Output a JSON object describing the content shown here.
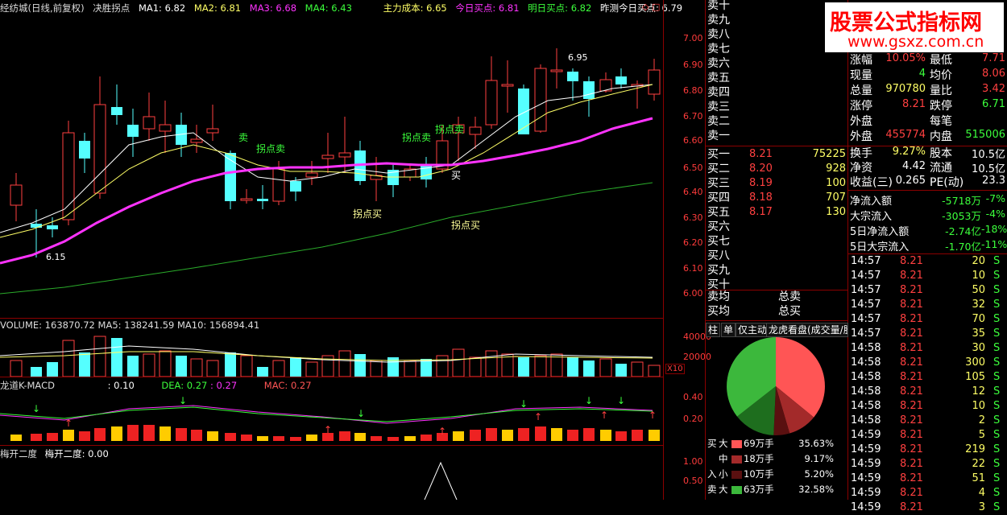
{
  "header": {
    "stock": "经纺城(日线,前复权)",
    "indicator": "决胜拐点",
    "ma1": "MA1: 6.82",
    "ma2": "MA2: 6.81",
    "ma3": "MA3: 6.68",
    "ma4": "MA4: 6.43",
    "cost": "主力成本: 6.65",
    "today_buy": "今日买点: 6.81",
    "tomorrow_buy": "明日买点: 6.82",
    "yesterday_buy": "昨测今日买点: 6.79",
    "corner": "◇ □"
  },
  "price_axis": [
    "7.00",
    "6.90",
    "6.80",
    "6.70",
    "6.60",
    "6.50",
    "6.40",
    "6.30",
    "6.20",
    "6.10",
    "6.00"
  ],
  "annotations": {
    "high": "6.95",
    "low": "6.15",
    "sell1": "卖",
    "sell2": "拐点卖",
    "sell3": "拐点卖",
    "sell4": "拐点卖",
    "buy1": "买",
    "buy2": "拐点买",
    "buy3": "拐点买"
  },
  "volume": {
    "header": "VOLUME: 163870.72  MA5: 138241.59  MA10: 156894.41",
    "axis": [
      "40000",
      "20000"
    ],
    "unit": "X10"
  },
  "macd": {
    "title": "龙道K-MACD",
    "diff": ": 0.10",
    "dea": "DEA: 0.27",
    "dea2": ": 0.27",
    "mac": "MAC: 0.27",
    "axis": [
      "0.40",
      "0.20"
    ]
  },
  "open2": {
    "title": "梅开二度",
    "value": "梅开二度: 0.00",
    "axis": [
      "1.00",
      "0.50"
    ]
  },
  "order_book": {
    "sells": [
      "卖十",
      "卖九",
      "卖八",
      "卖七",
      "卖六",
      "卖五",
      "卖四",
      "卖三",
      "卖二",
      "卖一"
    ],
    "buys": [
      {
        "label": "买一",
        "price": "8.21",
        "vol": "75225"
      },
      {
        "label": "买二",
        "price": "8.20",
        "vol": "928"
      },
      {
        "label": "买三",
        "price": "8.19",
        "vol": "100"
      },
      {
        "label": "买四",
        "price": "8.18",
        "vol": "707"
      },
      {
        "label": "买五",
        "price": "8.17",
        "vol": "130"
      },
      {
        "label": "买六",
        "price": "",
        "vol": ""
      },
      {
        "label": "买七",
        "price": "",
        "vol": ""
      },
      {
        "label": "买八",
        "price": "",
        "vol": ""
      },
      {
        "label": "买九",
        "price": "",
        "vol": ""
      },
      {
        "label": "买十",
        "price": "",
        "vol": ""
      }
    ],
    "avg_sell": "卖均",
    "avg_buy": "买均",
    "total_sell": "总卖",
    "total_buy": "总买"
  },
  "tabs": [
    "柱",
    "单",
    "仅主动",
    "龙虎看盘(成交量/股"
  ],
  "pie": {
    "rows": [
      {
        "side": "买",
        "size": "大",
        "amount": "69万手",
        "pct": "35.63%",
        "color": "#ff5555"
      },
      {
        "side": "",
        "size": "中",
        "amount": "18万手",
        "pct": "9.17%",
        "color": "#a32a2a"
      },
      {
        "side": "入",
        "size": "小",
        "amount": "10万手",
        "pct": "5.20%",
        "color": "#5a1010"
      },
      {
        "side": "卖",
        "size": "大",
        "amount": "63万手",
        "pct": "32.58%",
        "color": "#3cb83c"
      }
    ]
  },
  "logo": {
    "name": "股票公式指标网",
    "url": "www.gsxz.com.cn"
  },
  "quote": {
    "rows": [
      {
        "l1": "涨幅",
        "v1": "10.05%",
        "c1": "#ff4040",
        "l2": "最低",
        "v2": "7.71",
        "c2": "#ff4040"
      },
      {
        "l1": "现量",
        "v1": "4",
        "c1": "#3cff3c",
        "l2": "均价",
        "v2": "8.06",
        "c2": "#ff4040"
      },
      {
        "l1": "总量",
        "v1": "970780",
        "c1": "#ffff66",
        "l2": "量比",
        "v2": "3.42",
        "c2": "#ff4040"
      },
      {
        "l1": "涨停",
        "v1": "8.21",
        "c1": "#ff4040",
        "l2": "跌停",
        "v2": "6.71",
        "c2": "#3cff3c"
      },
      {
        "l1": "外盘",
        "v1": "",
        "c1": "#ff4040",
        "l2": "每笔",
        "v2": "",
        "c2": "#fff"
      },
      {
        "l1": "外盘",
        "v1": "455774",
        "c1": "#ff4040",
        "l2": "内盘",
        "v2": "515006",
        "c2": "#3cff3c"
      }
    ],
    "rows2": [
      {
        "l1": "换手",
        "v1": "9.27%",
        "c1": "#ffff66",
        "l2": "股本",
        "v2": "10.5亿",
        "c2": "#fff"
      },
      {
        "l1": "净资",
        "v1": "4.42",
        "c1": "#fff",
        "l2": "流通",
        "v2": "10.5亿",
        "c2": "#fff"
      },
      {
        "l1": "收益(三)",
        "v1": "0.265",
        "c1": "#fff",
        "l2": "PE(动)",
        "v2": "23.3",
        "c2": "#fff"
      }
    ],
    "flows": [
      {
        "label": "净流入额",
        "val": "-5718万",
        "pct": "-7%"
      },
      {
        "label": "大宗流入",
        "val": "-3053万",
        "pct": "-4%"
      },
      {
        "label": "5日净流入额",
        "val": "-2.74亿",
        "pct": "-18%"
      },
      {
        "label": "5日大宗流入",
        "val": "-1.70亿",
        "pct": "-11%"
      }
    ]
  },
  "trades": [
    {
      "t": "14:57",
      "p": "8.21",
      "v": "20",
      "s": "S"
    },
    {
      "t": "14:57",
      "p": "8.21",
      "v": "10",
      "s": "S"
    },
    {
      "t": "14:57",
      "p": "8.21",
      "v": "50",
      "s": "S"
    },
    {
      "t": "14:57",
      "p": "8.21",
      "v": "32",
      "s": "S"
    },
    {
      "t": "14:57",
      "p": "8.21",
      "v": "70",
      "s": "S"
    },
    {
      "t": "14:57",
      "p": "8.21",
      "v": "35",
      "s": "S"
    },
    {
      "t": "14:58",
      "p": "8.21",
      "v": "30",
      "s": "S"
    },
    {
      "t": "14:58",
      "p": "8.21",
      "v": "300",
      "s": "S"
    },
    {
      "t": "14:58",
      "p": "8.21",
      "v": "105",
      "s": "S"
    },
    {
      "t": "14:58",
      "p": "8.21",
      "v": "12",
      "s": "S"
    },
    {
      "t": "14:58",
      "p": "8.21",
      "v": "10",
      "s": "S"
    },
    {
      "t": "14:58",
      "p": "8.21",
      "v": "2",
      "s": "S"
    },
    {
      "t": "14:59",
      "p": "8.21",
      "v": "5",
      "s": "S"
    },
    {
      "t": "14:59",
      "p": "8.21",
      "v": "219",
      "s": "S"
    },
    {
      "t": "14:59",
      "p": "8.21",
      "v": "22",
      "s": "S"
    },
    {
      "t": "14:59",
      "p": "8.21",
      "v": "51",
      "s": "S"
    },
    {
      "t": "14:59",
      "p": "8.21",
      "v": "4",
      "s": "S"
    },
    {
      "t": "14:59",
      "p": "8.21",
      "v": "3",
      "s": "S"
    }
  ]
}
